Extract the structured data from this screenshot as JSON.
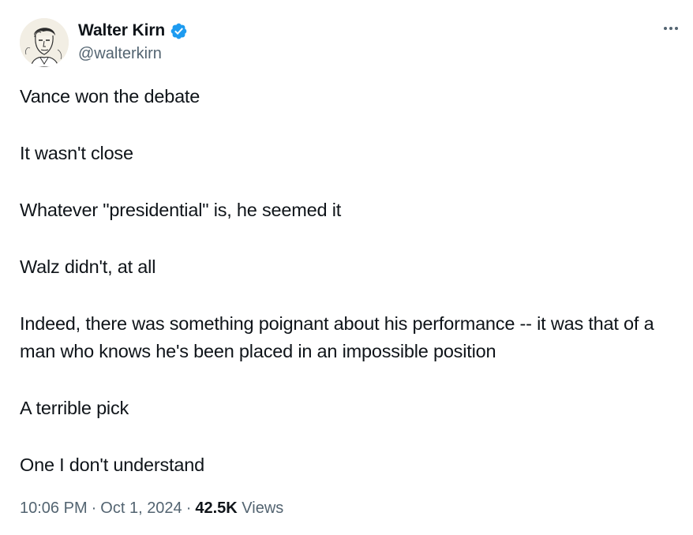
{
  "author": {
    "display_name": "Walter Kirn",
    "handle": "@walterkirn",
    "verified": true
  },
  "body": {
    "paragraphs": [
      "Vance won the debate",
      "It wasn't close",
      "Whatever \"presidential\" is, he seemed it",
      "Walz didn't, at all",
      "Indeed, there was something poignant about his performance -- it was that of a man who knows he's been placed in an impossible position",
      "A terrible pick",
      "One I don't understand"
    ]
  },
  "meta": {
    "time": "10:06 PM",
    "date": "Oct 1, 2024",
    "separator": "·",
    "views_count": "42.5K",
    "views_label": "Views"
  },
  "icons": {
    "verified": "verified-badge-icon",
    "more": "more-options-icon"
  },
  "colors": {
    "verified_blue": "#1d9bf0",
    "text_primary": "#0f1419",
    "text_secondary": "#536471"
  }
}
